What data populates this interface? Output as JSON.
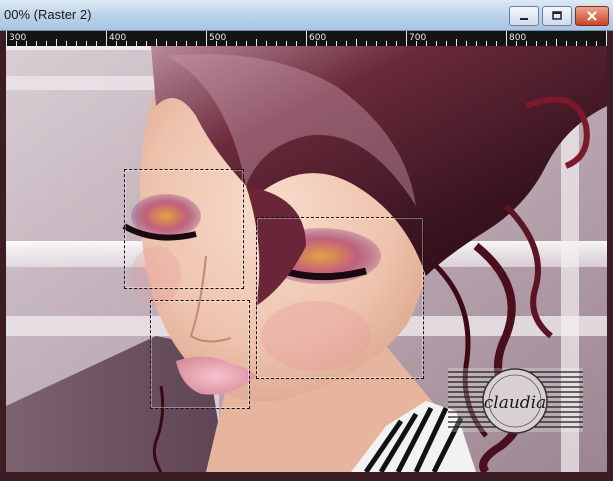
{
  "window": {
    "title": "00% (Raster 2)",
    "controls": [
      "minimize-icon",
      "maximize-icon",
      "close-icon"
    ]
  },
  "ruler": {
    "labels": [
      "300",
      "400",
      "500",
      "600",
      "700",
      "800"
    ]
  },
  "watermark": {
    "name": "claudia"
  },
  "colors": {
    "titlebar": "#b9d1ea",
    "ruler_bg": "#141414",
    "frame": "#3b1d23",
    "hair": "#5a1a2a",
    "skin": "#efc8b3"
  }
}
